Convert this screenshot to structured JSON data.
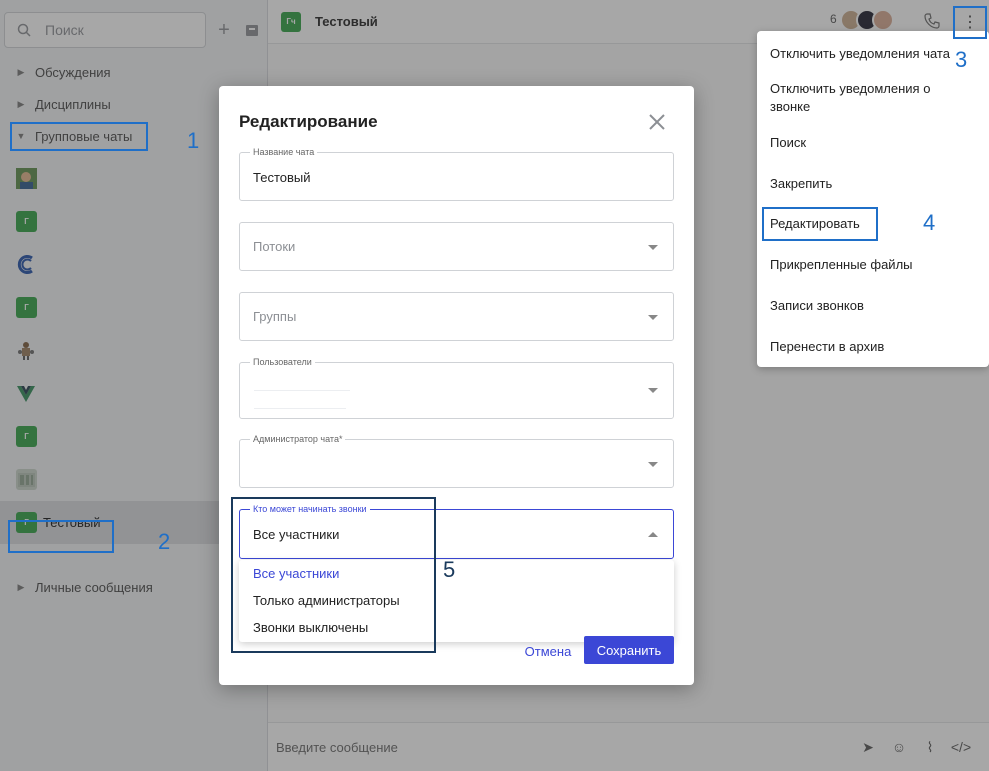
{
  "sidebar": {
    "search_placeholder": "Поиск",
    "sections": [
      "Обсуждения",
      "Дисциплины",
      "Групповые чаты",
      "Личные сообщения"
    ],
    "chats": [
      {
        "avatar_text": "",
        "avatar_color": "#4a7c3a",
        "name": ""
      },
      {
        "avatar_text": "Г",
        "avatar_color": "#2ea043",
        "name": ""
      },
      {
        "avatar_text": "",
        "avatar_color": "#ffffff",
        "name": ""
      },
      {
        "avatar_text": "Г",
        "avatar_color": "#2ea043",
        "name": ""
      },
      {
        "avatar_text": "",
        "avatar_color": "#e8e8e8",
        "name": ""
      },
      {
        "avatar_text": "",
        "avatar_color": "#ffffff",
        "name": ""
      },
      {
        "avatar_text": "Г",
        "avatar_color": "#2ea043",
        "name": ""
      },
      {
        "avatar_text": "",
        "avatar_color": "#c9d3c9",
        "name": ""
      },
      {
        "avatar_text": "Г",
        "avatar_color": "#2ea043",
        "name": "Тестовый"
      }
    ]
  },
  "header": {
    "avatar_text": "Гч",
    "title": "Тестовый",
    "member_count": "6"
  },
  "composer": {
    "placeholder": "Введите сообщение"
  },
  "context_menu": {
    "items": [
      "Отключить уведомления чата",
      "Отключить уведомления о звонке",
      "Поиск",
      "Закрепить",
      "Редактировать",
      "Прикрепленные файлы",
      "Записи звонков",
      "Перенести в архив"
    ]
  },
  "modal": {
    "title": "Редактирование",
    "fields": {
      "chat_name": {
        "label": "Название чата",
        "value": "Тестовый"
      },
      "streams": {
        "placeholder": "Потоки"
      },
      "groups": {
        "placeholder": "Группы"
      },
      "users": {
        "label": "Пользователи"
      },
      "admin": {
        "label": "Администратор чата*"
      },
      "calls": {
        "label": "Кто может начинать звонки",
        "value": "Все участники"
      }
    },
    "call_options": [
      "Все участники",
      "Только администраторы",
      "Звонки выключены"
    ],
    "cancel_label": "Отмена",
    "save_label": "Сохранить"
  },
  "annotations": [
    "1",
    "2",
    "3",
    "4",
    "5"
  ],
  "colors": {
    "accent": "#3b47d6",
    "annotation_blue": "#1f6fc8",
    "annotation_dark": "#1a3a5c",
    "group_avatar": "#2ea043"
  }
}
